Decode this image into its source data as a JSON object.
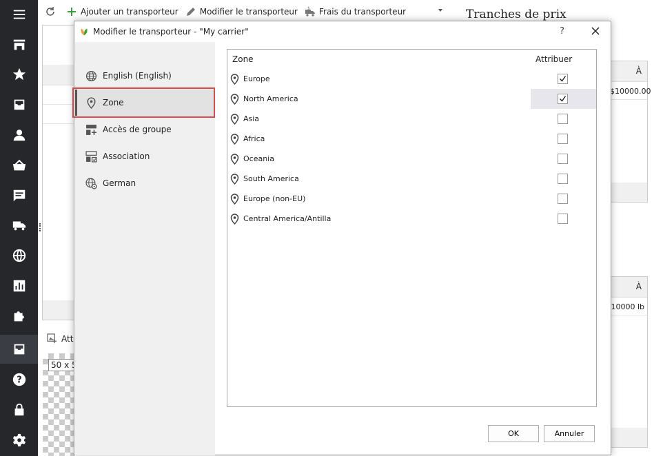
{
  "toolbar": {
    "add_label": "Ajouter un transporteur",
    "edit_label": "Modifier le transporteur",
    "fees_label": "Frais du transporteur"
  },
  "background": {
    "title": "Tranches de prix",
    "header_to_1": "À",
    "value_1": "$10000.00",
    "header_to_2": "À",
    "value_2": "10000 lb",
    "attach_label": "Att",
    "image_size_label": "50 x 5"
  },
  "dialog": {
    "title": "Modifier le transporteur - \"My carrier\"",
    "help": "?",
    "nav": [
      {
        "label": "English (English)"
      },
      {
        "label": "Zone"
      },
      {
        "label": "Accès de groupe"
      },
      {
        "label": "Association"
      },
      {
        "label": "German"
      }
    ],
    "grid": {
      "col_zone": "Zone",
      "col_assign": "Attribuer",
      "rows": [
        {
          "name": "Europe",
          "checked": true
        },
        {
          "name": "North America",
          "checked": true
        },
        {
          "name": "Asia",
          "checked": false
        },
        {
          "name": "Africa",
          "checked": false
        },
        {
          "name": "Oceania",
          "checked": false
        },
        {
          "name": "South America",
          "checked": false
        },
        {
          "name": "Europe (non-EU)",
          "checked": false
        },
        {
          "name": "Central America/Antilla",
          "checked": false
        }
      ]
    },
    "ok_label": "OK",
    "cancel_label": "Annuler"
  }
}
